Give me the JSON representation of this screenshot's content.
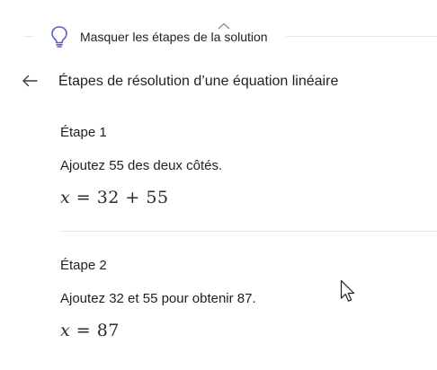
{
  "toggle": {
    "label": "Masquer les étapes de la solution",
    "icon": "lightbulb-icon"
  },
  "header": {
    "back_icon": "arrow-left-icon",
    "title": "Étapes de résolution d’une équation linéaire"
  },
  "steps": [
    {
      "heading": "Étape 1",
      "description": "Ajoutez 55 des deux côtés.",
      "equation_var": "x",
      "equation_rest": " = 32 + 55"
    },
    {
      "heading": "Étape 2",
      "description": "Ajoutez 32 et 55 pour obtenir 87.",
      "equation_var": "x",
      "equation_rest": " = 87"
    }
  ],
  "colors": {
    "accent": "#5b5fc7",
    "text": "#1f1f1f",
    "divider": "#e6e6e6"
  }
}
